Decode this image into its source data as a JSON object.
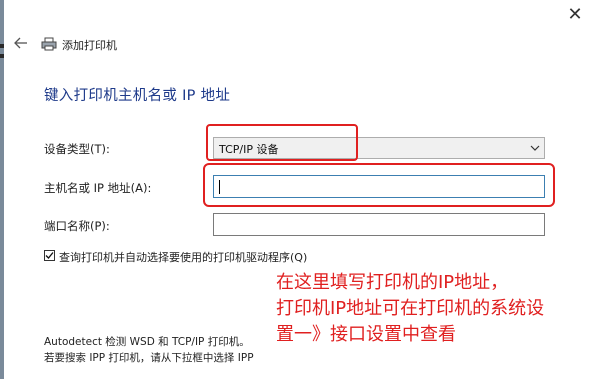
{
  "window": {
    "title": "添加打印机",
    "close_glyph": "✕"
  },
  "heading": "键入打印机主机名或 IP 地址",
  "form": {
    "device_type_label": "设备类型(T):",
    "device_type_value": "TCP/IP 设备",
    "hostname_label": "主机名或 IP 地址(A):",
    "hostname_value": "",
    "port_label": "端口名称(P):",
    "port_value": "",
    "auto_select_label": "查询打印机并自动选择要使用的打印机驱动程序(Q)",
    "auto_select_checked": true
  },
  "annotation": {
    "lines": [
      "在这里填写打印机的IP地址，",
      "打印机IP地址可在打印机的系统设",
      "置一》接口设置中查看"
    ],
    "color": "#e02020"
  },
  "footer": {
    "line1": "Autodetect 检测 WSD 和 TCP/IP 打印机。",
    "line2": "若要搜索 IPP 打印机，请从下拉框中选择 IPP"
  },
  "icons": {
    "back": "arrow-left-icon",
    "printer": "printer-icon",
    "close": "close-icon",
    "chevron": "chevron-down-icon",
    "check": "check-icon"
  },
  "colors": {
    "heading": "#1e3a8a",
    "annotation_red": "#e02020",
    "focus_border": "#3c7fb1"
  }
}
